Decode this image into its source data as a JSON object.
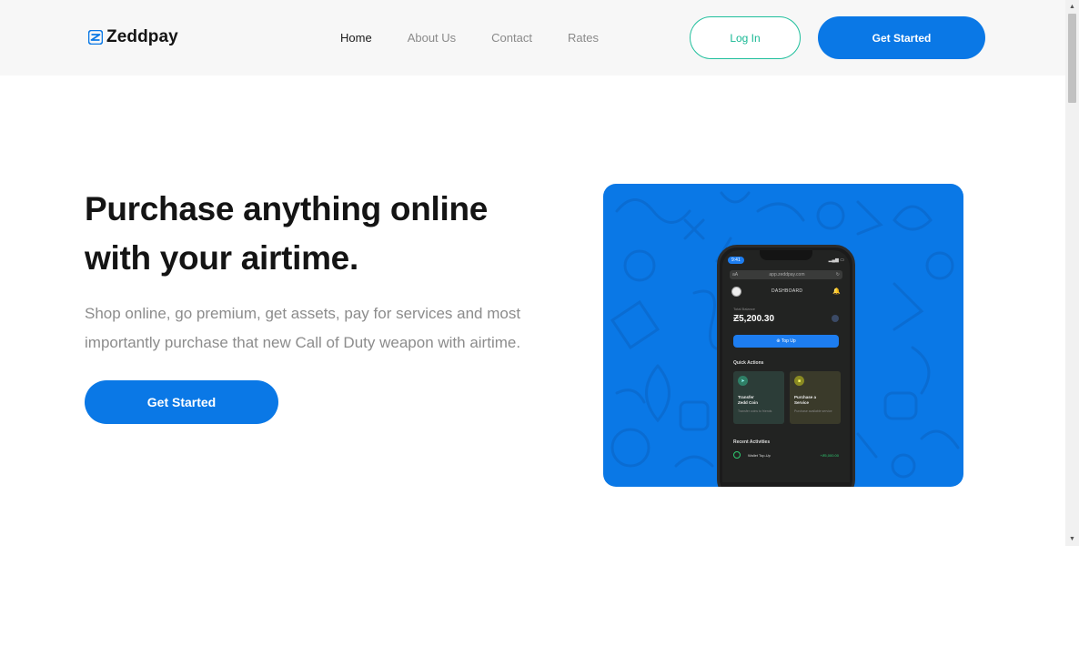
{
  "brand": {
    "name": "Zeddpay",
    "logo_icon": "zeddpay-logo-icon"
  },
  "nav": {
    "items": [
      "Home",
      "About Us",
      "Contact",
      "Rates"
    ],
    "active_index": 0
  },
  "header": {
    "login_label": "Log In",
    "get_started_label": "Get Started"
  },
  "hero": {
    "title_line1": "Purchase anything online",
    "title_line2": "with your airtime.",
    "subtitle_line1": "Shop online, go premium, get assets, pay for services and most",
    "subtitle_line2": "importantly purchase that new Call of Duty weapon with airtime.",
    "cta_label": "Get Started"
  },
  "phone": {
    "time": "9:41",
    "url": "app.zeddpay.com",
    "url_prefix": "aA",
    "dashboard_label": "DASHBOARD",
    "balance_label": "Total Balance",
    "balance": "Ƶ5,200.30",
    "topup_label": "Top Up",
    "quick_actions_title": "Quick Actions",
    "quick_actions": [
      {
        "title_line1": "Transfer",
        "title_line2": "Zedd Coin",
        "sub": "Transfer coins to friends"
      },
      {
        "title_line1": "Purchase a",
        "title_line2": "Service",
        "sub": "Purchase available service"
      }
    ],
    "recent_title": "Recent Activities",
    "recent": [
      {
        "name": "Wallet Top-Up",
        "amount": "+Ƶ5,000.00"
      }
    ]
  },
  "colors": {
    "primary": "#0a78e6",
    "accent_teal": "#1fbf9c",
    "header_bg": "#f7f7f7"
  }
}
